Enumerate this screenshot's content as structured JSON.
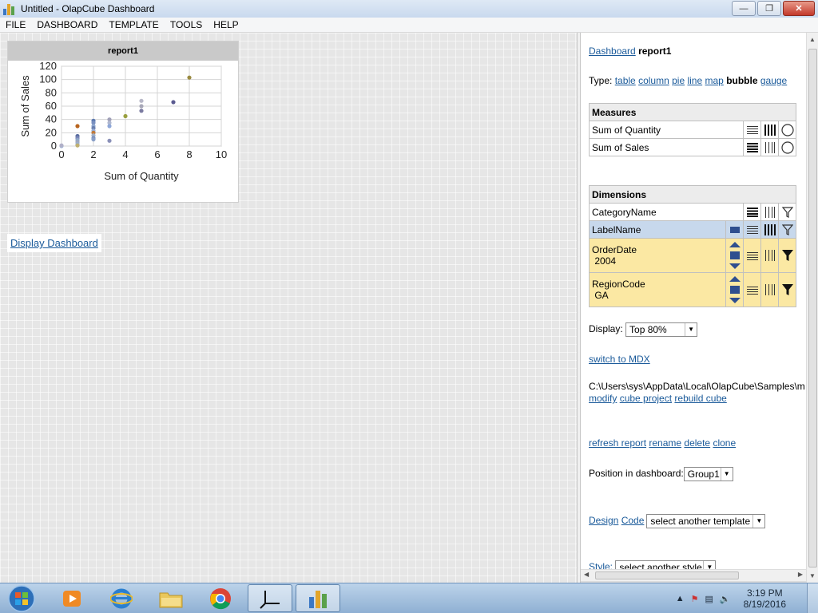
{
  "window": {
    "title": "Untitled - OlapCube Dashboard"
  },
  "menu": [
    "FILE",
    "DASHBOARD",
    "TEMPLATE",
    "TOOLS",
    "HELP"
  ],
  "report_card": {
    "title": "report1",
    "chart_data": {
      "type": "scatter",
      "xlabel": "Sum of Quantity",
      "ylabel": "Sum of Sales",
      "xlim": [
        0,
        10
      ],
      "ylim": [
        0,
        120
      ],
      "xticks": [
        0,
        2,
        4,
        6,
        8,
        10
      ],
      "yticks": [
        0,
        20,
        40,
        60,
        80,
        100,
        120
      ],
      "grid": true,
      "points": [
        {
          "x": 0,
          "y": 0,
          "color": "#9fb8d8"
        },
        {
          "x": 0,
          "y": 1,
          "color": "#b0b0c8"
        },
        {
          "x": 1,
          "y": 30,
          "color": "#b8651f"
        },
        {
          "x": 1,
          "y": 15,
          "color": "#5a6ea0"
        },
        {
          "x": 1,
          "y": 12,
          "color": "#7a86b8"
        },
        {
          "x": 1,
          "y": 9,
          "color": "#8fa8c8"
        },
        {
          "x": 1,
          "y": 6,
          "color": "#a0a8c0"
        },
        {
          "x": 1,
          "y": 3,
          "color": "#9ab0d0"
        },
        {
          "x": 1,
          "y": 1,
          "color": "#c0b070"
        },
        {
          "x": 2,
          "y": 38,
          "color": "#5a78b0"
        },
        {
          "x": 2,
          "y": 35,
          "color": "#7a90c0"
        },
        {
          "x": 2,
          "y": 30,
          "color": "#8fa8d0"
        },
        {
          "x": 2,
          "y": 27,
          "color": "#6a80b0"
        },
        {
          "x": 2,
          "y": 23,
          "color": "#9ab0d8"
        },
        {
          "x": 2,
          "y": 20,
          "color": "#c07a3a"
        },
        {
          "x": 2,
          "y": 16,
          "color": "#a0b0c8"
        },
        {
          "x": 2,
          "y": 12,
          "color": "#7890c0"
        },
        {
          "x": 2,
          "y": 10,
          "color": "#8aa0c8"
        },
        {
          "x": 3,
          "y": 40,
          "color": "#a0a0b8"
        },
        {
          "x": 3,
          "y": 35,
          "color": "#b0b8d0"
        },
        {
          "x": 3,
          "y": 30,
          "color": "#8fa8d8"
        },
        {
          "x": 3,
          "y": 8,
          "color": "#8a90b8"
        },
        {
          "x": 4,
          "y": 45,
          "color": "#9aa040"
        },
        {
          "x": 5,
          "y": 68,
          "color": "#b8b8c8"
        },
        {
          "x": 5,
          "y": 60,
          "color": "#a8a8b8"
        },
        {
          "x": 5,
          "y": 53,
          "color": "#7a7aa0"
        },
        {
          "x": 7,
          "y": 66,
          "color": "#5a5a90"
        },
        {
          "x": 8,
          "y": 103,
          "color": "#9a8a40"
        }
      ]
    }
  },
  "display_link": "Display Dashboard",
  "panel": {
    "breadcrumb_link": "Dashboard",
    "breadcrumb_current": "report1",
    "type_label": "Type:",
    "types": [
      {
        "label": "table",
        "active": false
      },
      {
        "label": "column",
        "active": false
      },
      {
        "label": "pie",
        "active": false
      },
      {
        "label": "line",
        "active": false
      },
      {
        "label": "map",
        "active": false
      },
      {
        "label": "bubble",
        "active": true
      },
      {
        "label": "gauge",
        "active": false
      }
    ],
    "measures_header": "Measures",
    "measures": [
      "Sum of Quantity",
      "Sum of Sales"
    ],
    "dimensions_header": "Dimensions",
    "dim_category": "CategoryName",
    "dim_label": "LabelName",
    "dim_orderdate": "OrderDate",
    "dim_orderdate_value": "2004",
    "dim_region": "RegionCode",
    "dim_region_value": "GA",
    "display_label": "Display:",
    "display_value": "Top 80%",
    "switch_mdx": "switch to MDX",
    "path": "C:\\Users\\sys\\AppData\\Local\\OlapCube\\Samples\\m",
    "cube_links": [
      "modify",
      "cube project",
      "rebuild cube"
    ],
    "report_links": [
      "refresh report",
      "rename",
      "delete",
      "clone"
    ],
    "position_label": "Position in dashboard:",
    "position_value": "Group1",
    "design_link": "Design",
    "code_link": "Code",
    "template_select": "select another template",
    "style_label": "Style:",
    "style_select": "select another style"
  },
  "taskbar": {
    "time": "3:19 PM",
    "date": "8/19/2016"
  }
}
